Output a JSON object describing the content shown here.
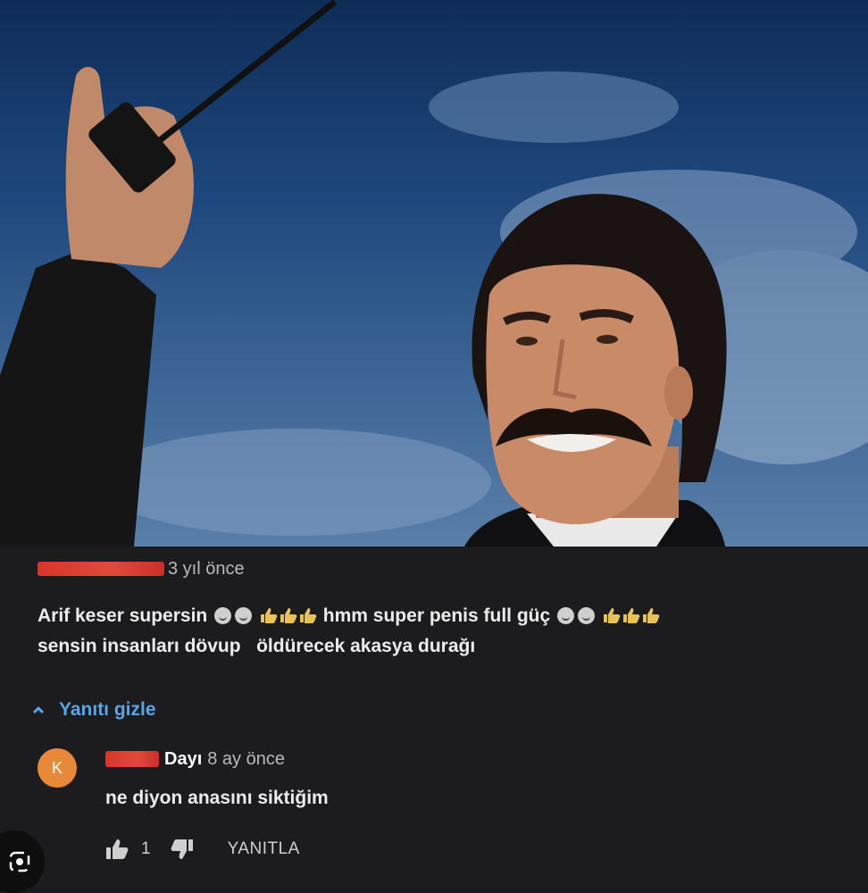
{
  "video": {
    "description_icon": "video-frame"
  },
  "comment": {
    "time": "3 yıl önce",
    "line1_a": "Arif keser supersin",
    "line1_b": "hmm super penis full güç",
    "line2_a": "sensin insanları dövup",
    "line2_b": "öldürecek akasya durağı"
  },
  "reply_toggle": {
    "label": "Yanıtı gizle"
  },
  "reply": {
    "avatar_letter": "K",
    "author_tail": "Dayı",
    "time": "8 ay önce",
    "text": "ne diyon anasını siktiğim",
    "like_count": "1",
    "reply_label": "YANITLA"
  },
  "colors": {
    "background": "#1c1c1e",
    "link": "#5aa4e8",
    "avatar": "#e8893a",
    "redaction": "#d9342b"
  }
}
